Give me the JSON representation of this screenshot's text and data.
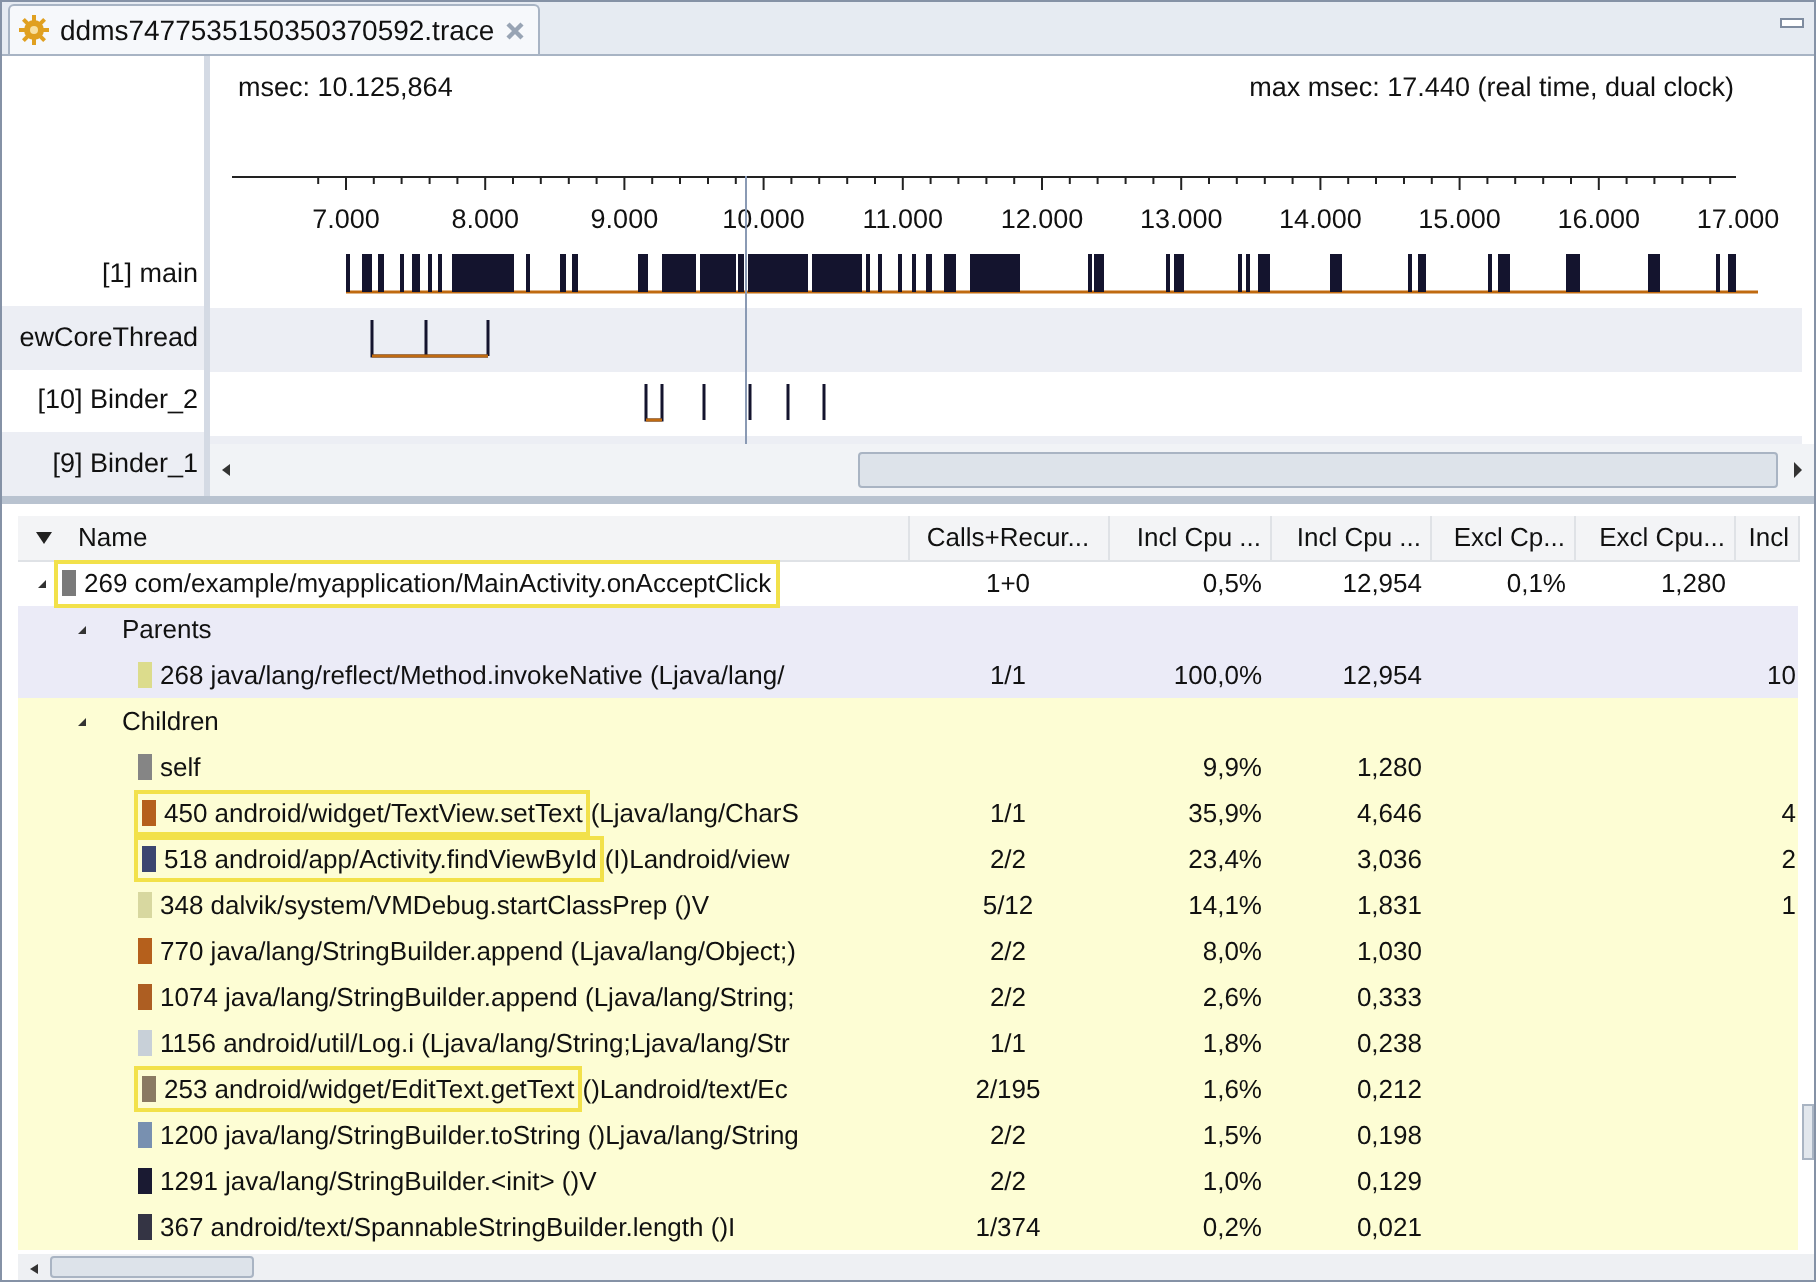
{
  "tab": {
    "title": "ddms7477535150350370592.trace"
  },
  "timeline": {
    "msec": "msec: 10.125,864",
    "max_msec": "max msec: 17.440 (real time, dual clock)",
    "axis_ticks": [
      "7.000",
      "8.000",
      "9.000",
      "10.000",
      "11.000",
      "12.000",
      "13.000",
      "14.000",
      "15.000",
      "16.000",
      "17.000"
    ],
    "threads": [
      {
        "label": "[1] main"
      },
      {
        "label": "ewCoreThread"
      },
      {
        "label": "[10] Binder_2"
      },
      {
        "label": "[9] Binder_1"
      }
    ]
  },
  "profile": {
    "columns": [
      "Name",
      "Calls+Recur...",
      "Incl Cpu ...",
      "Incl Cpu ...",
      "Excl Cp...",
      "Excl Cpu...",
      "Incl"
    ],
    "rows": [
      {
        "kind": "method",
        "expanded": true,
        "highlighted": true,
        "color": "#7a7a7a",
        "name": "269 com/example/myapplication/MainActivity.onAcceptClick",
        "cells": {
          "calls": "1+0",
          "incl_pct": "0,5%",
          "incl_time": "12,954",
          "excl_pct": "0,1%",
          "excl_time": "1,280"
        },
        "children": [
          {
            "kind": "parents",
            "label": "Parents",
            "expanded": true,
            "children": [
              {
                "kind": "method",
                "highlighted": false,
                "color": "#dcdc8c",
                "name": "268 java/lang/reflect/Method.invokeNative (Ljava/lang/",
                "cells": {
                  "calls": "1/1",
                  "incl_pct": "100,0%",
                  "incl_time": "12,954",
                  "column_7": "10"
                }
              }
            ]
          },
          {
            "kind": "children",
            "label": "Children",
            "expanded": true,
            "children": [
              {
                "kind": "method",
                "highlighted": false,
                "color": "#858585",
                "name": "self",
                "cells": {
                  "incl_pct": "9,9%",
                  "incl_time": "1,280"
                }
              },
              {
                "kind": "method",
                "highlighted": true,
                "color": "#b5601c",
                "name": "450 android/widget/TextView.setText",
                "signature": "(Ljava/lang/CharS",
                "cells": {
                  "calls": "1/1",
                  "incl_pct": "35,9%",
                  "incl_time": "4,646",
                  "column_7": "4"
                }
              },
              {
                "kind": "method",
                "highlighted": true,
                "color": "#3c4670",
                "name": "518 android/app/Activity.findViewById",
                "signature": "(I)Landroid/view",
                "cells": {
                  "calls": "2/2",
                  "incl_pct": "23,4%",
                  "incl_time": "3,036",
                  "column_7": "2"
                }
              },
              {
                "kind": "method",
                "highlighted": false,
                "color": "#d8d8a0",
                "name": "348 dalvik/system/VMDebug.startClassPrep ()V",
                "cells": {
                  "calls": "5/12",
                  "incl_pct": "14,1%",
                  "incl_time": "1,831",
                  "column_7": "1"
                }
              },
              {
                "kind": "method",
                "highlighted": false,
                "color": "#b5601c",
                "name": "770 java/lang/StringBuilder.append (Ljava/lang/Object;)",
                "cells": {
                  "calls": "2/2",
                  "incl_pct": "8,0%",
                  "incl_time": "1,030"
                }
              },
              {
                "kind": "method",
                "highlighted": false,
                "color": "#ad5e22",
                "name": "1074 java/lang/StringBuilder.append (Ljava/lang/String;",
                "cells": {
                  "calls": "2/2",
                  "incl_pct": "2,6%",
                  "incl_time": "0,333"
                }
              },
              {
                "kind": "method",
                "highlighted": false,
                "color": "#c8d0d8",
                "name": "1156 android/util/Log.i (Ljava/lang/String;Ljava/lang/Str",
                "cells": {
                  "calls": "1/1",
                  "incl_pct": "1,8%",
                  "incl_time": "0,238"
                }
              },
              {
                "kind": "method",
                "highlighted": true,
                "color": "#8a7a62",
                "name": "253 android/widget/EditText.getText",
                "signature": "()Landroid/text/Ec",
                "cells": {
                  "calls": "2/195",
                  "incl_pct": "1,6%",
                  "incl_time": "0,212"
                }
              },
              {
                "kind": "method",
                "highlighted": false,
                "color": "#7890b0",
                "name": "1200 java/lang/StringBuilder.toString ()Ljava/lang/String",
                "cells": {
                  "calls": "2/2",
                  "incl_pct": "1,5%",
                  "incl_time": "0,198"
                }
              },
              {
                "kind": "method",
                "highlighted": false,
                "color": "#1a1a32",
                "name": "1291 java/lang/StringBuilder.<init> ()V",
                "cells": {
                  "calls": "2/2",
                  "incl_pct": "1,0%",
                  "incl_time": "0,129"
                }
              },
              {
                "kind": "method",
                "highlighted": false,
                "color": "#343444",
                "name": "367 android/text/SpannableStringBuilder.length ()I",
                "cells": {
                  "calls": "1/374",
                  "incl_pct": "0,2%",
                  "incl_time": "0,021"
                }
              }
            ]
          }
        ]
      }
    ]
  }
}
